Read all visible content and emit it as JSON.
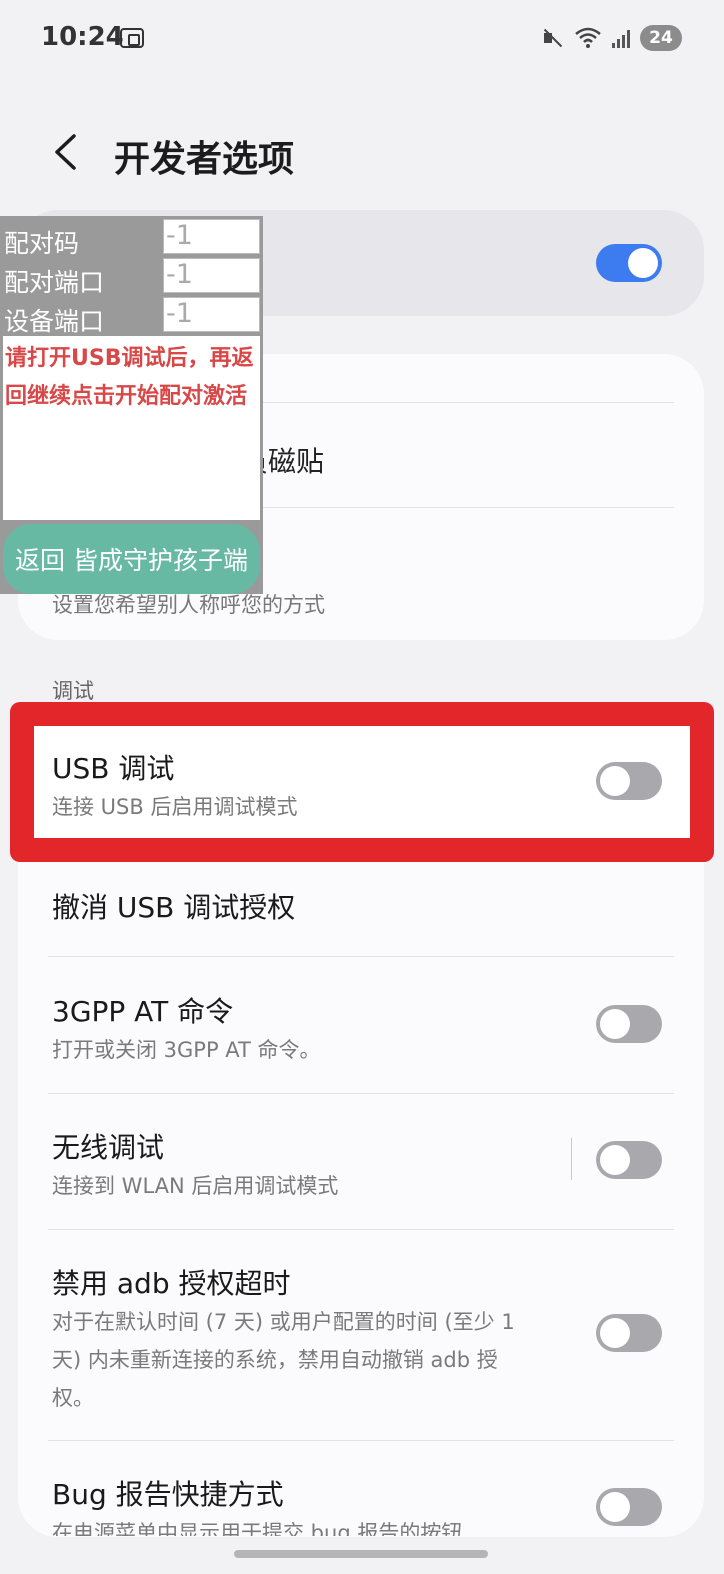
{
  "status_bar": {
    "time": "10:24",
    "battery": "24"
  },
  "header": {
    "title": "开发者选项"
  },
  "developer_options": {
    "master_switch_on": true
  },
  "cards": {
    "quick_tile_partial": "员磁贴",
    "pronoun_sub_partial": "设置您希望别人称呼您的方式"
  },
  "section": {
    "debugging_label": "调试"
  },
  "rows": {
    "usb_debugging": {
      "title": "USB 调试",
      "subtitle": "连接 USB 后启用调试模式",
      "on": false
    },
    "revoke_usb": {
      "title": "撤消 USB 调试授权"
    },
    "at_commands": {
      "title": "3GPP AT 命令",
      "subtitle": "打开或关闭 3GPP AT 命令。",
      "on": false
    },
    "wireless_debugging": {
      "title": "无线调试",
      "subtitle": "连接到 WLAN 后启用调试模式",
      "on": false
    },
    "adb_timeout": {
      "title": "禁用 adb 授权超时",
      "subtitle_lines": [
        "对于在默认时间 (7 天) 或用户配置的时间 (至少 1",
        "天) 内未重新连接的系统，禁用自动撤销 adb 授",
        "权。"
      ],
      "on": false
    },
    "bug_report": {
      "title": "Bug 报告快捷方式",
      "subtitle": "在电源菜单中显示用于提交 bug 报告的按钮",
      "on": false
    }
  },
  "overlay": {
    "pair_code_label": "配对码",
    "pair_code_value": "-1",
    "pair_port_label": "配对端口",
    "pair_port_value": "-1",
    "device_port_label": "设备端口",
    "device_port_value": "-1",
    "message": "请打开USB调试后，再返回继续点击开始配对激活",
    "back_button": "返回 皆成守护孩子端"
  },
  "colors": {
    "accent": "#3d7bf0",
    "highlight": "#e3262a",
    "overlay_button": "#68b9a3",
    "overlay_message": "#d84848"
  }
}
